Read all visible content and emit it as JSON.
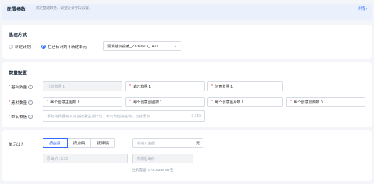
{
  "header": {
    "title": "配置参数",
    "description": "确定基建数量、调整设计字段设置。",
    "link": "详情"
  },
  "basic": {
    "title": "基建方式",
    "radio_new": "新建计划",
    "radio_existing": "在已有计划下新建单元",
    "selected_plan": "润滑授权投编_20260610_1421..."
  },
  "quantity": {
    "title": "数量配置",
    "rows": [
      {
        "label": "基础数量",
        "fields": [
          {
            "text": "计划数量 1",
            "disabled": true
          },
          {
            "text": "单元数量 1"
          },
          {
            "text": "创意数量 1"
          }
        ]
      },
      {
        "label": "素材数量",
        "fields": [
          {
            "text": "每个创意主图数 1"
          },
          {
            "text": "每个创意副图数 1"
          },
          {
            "text": "每个创意图片数 1"
          },
          {
            "text": "每个创意视频数 0"
          }
        ]
      }
    ],
    "naming_label": "命名模板",
    "naming_placeholder": "系统将根据输入内容批量生成计划、单元和创意名称。支持添加...",
    "naming_count": "0 / 25"
  },
  "bid": {
    "label": "单元出价",
    "options": [
      "按金额",
      "按加價",
      "按降價"
    ],
    "amount_placeholder": "请输入金额",
    "unit": "元",
    "original_price": "原出价 11.30",
    "modified_price": "修改后出价",
    "range_hint": "出价范围: 0.01~9999.99 元"
  }
}
